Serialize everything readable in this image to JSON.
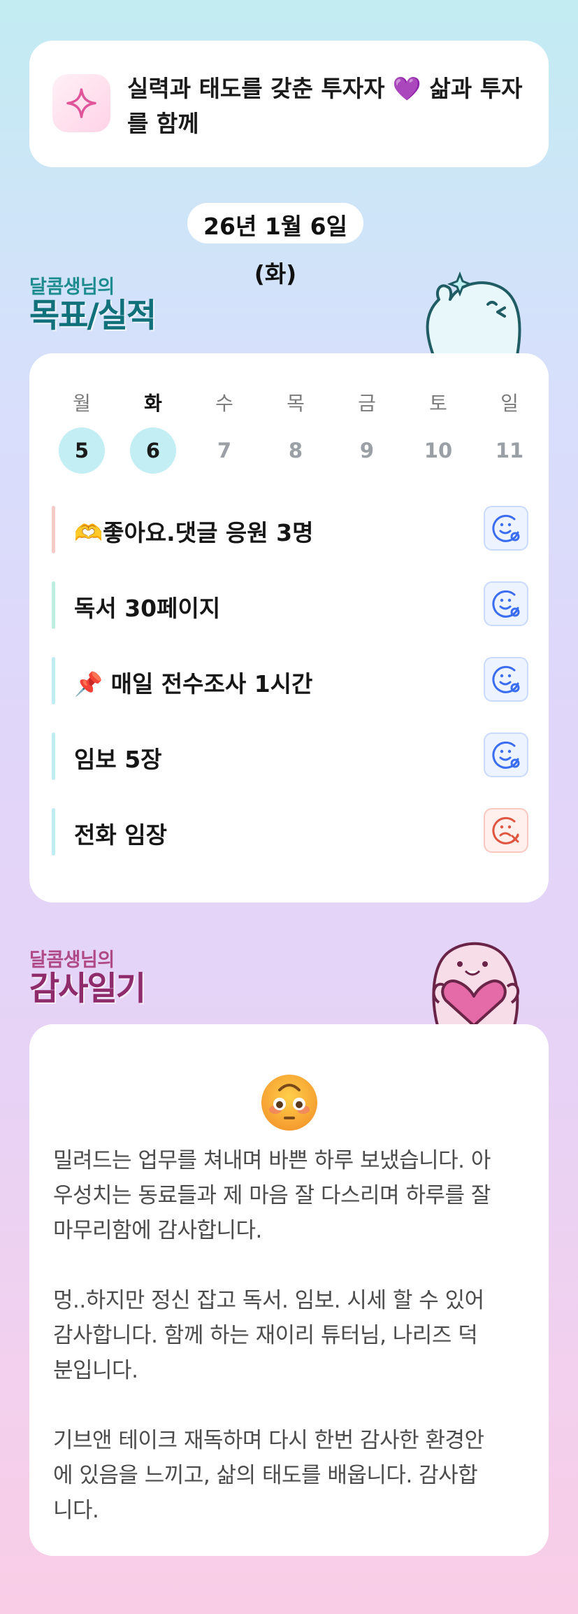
{
  "motto": {
    "line1": "실력과 태도를 갖춘 투자자 ",
    "heart": "💜",
    "line2": " 삶과 투자를 함께",
    "icon": "sparkle-icon"
  },
  "date": "26년 1월 6일(화)",
  "goals_section": {
    "subtitle": "달콤생님의",
    "title": "목표/실적",
    "days": [
      {
        "label": "월",
        "num": "5",
        "done": true,
        "active": false
      },
      {
        "label": "화",
        "num": "6",
        "done": true,
        "active": true
      },
      {
        "label": "수",
        "num": "7",
        "done": false,
        "active": false
      },
      {
        "label": "목",
        "num": "8",
        "done": false,
        "active": false
      },
      {
        "label": "금",
        "num": "9",
        "done": false,
        "active": false
      },
      {
        "label": "토",
        "num": "10",
        "done": false,
        "active": false
      },
      {
        "label": "일",
        "num": "11",
        "done": false,
        "active": false
      }
    ],
    "goals": [
      {
        "text": "🫶좋아요.댓글 응원 3명",
        "status": "done",
        "bar_color": "#f6cac6"
      },
      {
        "text": "독서 30페이지",
        "status": "done",
        "bar_color": "#bdeee0"
      },
      {
        "text": "📌 매일 전수조사 1시간",
        "status": "done",
        "bar_color": "#bfecf3"
      },
      {
        "text": "임보 5장",
        "status": "done",
        "bar_color": "#bfecf3"
      },
      {
        "text": "전화 임장",
        "status": "not-done",
        "bar_color": "#bfecf3"
      }
    ],
    "colors": {
      "done_icon": "#3b6df0",
      "fail_icon": "#e0553f"
    }
  },
  "diary_section": {
    "subtitle": "달콤생님의",
    "title": "감사일기",
    "emoji": "flushed-face-emoji",
    "text": "밀려드는 업무를 쳐내며 바쁜 하루 보냈습니다. 아\n우성치는 동료들과 제 마음 잘 다스리며 하루를 잘\n마무리함에 감사합니다.\n\n멍..하지만 정신 잡고 독서. 임보. 시세 할 수 있어\n감사합니다. 함께 하는 재이리 튜터님, 나리즈 덕\n분입니다.\n\n기브앤 테이크 재독하며 다시 한번 감사한 환경안\n에 있음을 느끼고, 삶의 태도를 배웁니다. 감사합\n니다."
  }
}
